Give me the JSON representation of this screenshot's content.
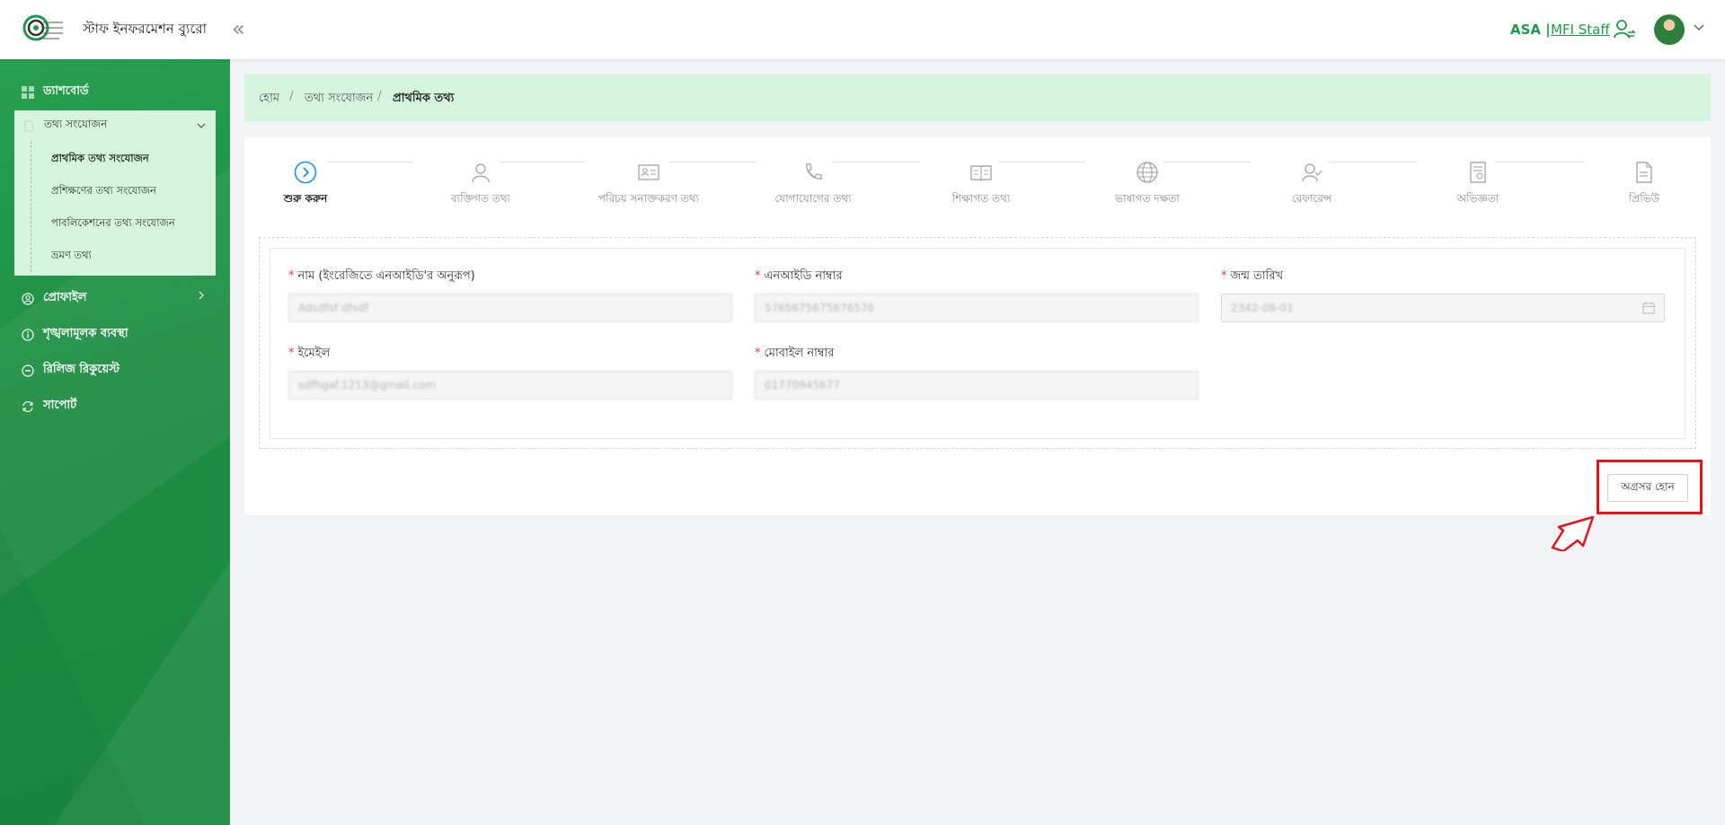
{
  "header": {
    "logo_text": "Microcredit Regulatory Authority",
    "app_title": "স্টাফ ইনফরমেশন ব্যুরো",
    "collapse_icon": "«",
    "org_code": "ASA |",
    "role_label": "MFI Staff",
    "icons": [
      "switch-user-icon",
      "avatar",
      "chevron-down-icon"
    ]
  },
  "sidebar": {
    "items": [
      {
        "label": "ড্যাশবোর্ড",
        "icon": "dashboard-icon"
      },
      {
        "label": "প্রোফাইল",
        "icon": "user-circle-icon"
      },
      {
        "label": "শৃঙ্খলামূলক ব্যবস্থা",
        "icon": "info-icon"
      },
      {
        "label": "রিলিজ রিকুয়েস্ট",
        "icon": "minus-circle-icon"
      },
      {
        "label": "সাপোর্ট",
        "icon": "sync-icon"
      }
    ],
    "submenu": {
      "label": "তথ্য সংযোজন",
      "items": [
        "প্রাথমিক তথ্য সংযোজন",
        "প্রশিক্ষণের তথ্য সংযোজন",
        "পাবলিকেশনের তথ্য সংযোজন",
        "ভ্রমণ তথ্য"
      ]
    }
  },
  "breadcrumb": {
    "items": [
      "হোম",
      "তথ্য সংযোজন",
      "প্রাথমিক তথ্য"
    ],
    "separator": "/"
  },
  "steps": [
    {
      "label": "শুরু করুন",
      "icon": "play-circle-icon",
      "active": true
    },
    {
      "label": "ব্যক্তিগত তথ্য",
      "icon": "user-icon"
    },
    {
      "label": "পরিচয় সনাক্তকরণ তথ্য",
      "icon": "id-card-icon"
    },
    {
      "label": "যোগাযোগের তথ্য",
      "icon": "phone-icon"
    },
    {
      "label": "শিক্ষাগত তথ্য",
      "icon": "book-icon"
    },
    {
      "label": "ভাষাগত দক্ষতা",
      "icon": "globe-icon"
    },
    {
      "label": "রেফারেন্স",
      "icon": "users-icon"
    },
    {
      "label": "অভিজ্ঞতা",
      "icon": "certificate-icon"
    },
    {
      "label": "প্রিভিউ",
      "icon": "file-icon"
    }
  ],
  "form": {
    "required_mark": "*",
    "name": {
      "label": "নাম (ইংরেজিতে এনআইডি'র অনুরূপ)",
      "value": "Adsdfsf dfsdf"
    },
    "nid": {
      "label": "এনআইডি নাম্বার",
      "value": "5765675675676576"
    },
    "dob": {
      "label": "জন্ম তারিখ",
      "value": "2342-08-01"
    },
    "email": {
      "label": "ইমেইল",
      "value": "sdfhgaf.1213@gmail.com"
    },
    "mobile": {
      "label": "মোবাইল নাম্বার",
      "value": "01770945677"
    }
  },
  "actions": {
    "proceed_label": "অগ্রসর হোন"
  },
  "colors": {
    "brand_green": "#1f9a4a",
    "highlight_red": "#e3141b",
    "breadcrumb_bg": "#d5f5df"
  }
}
